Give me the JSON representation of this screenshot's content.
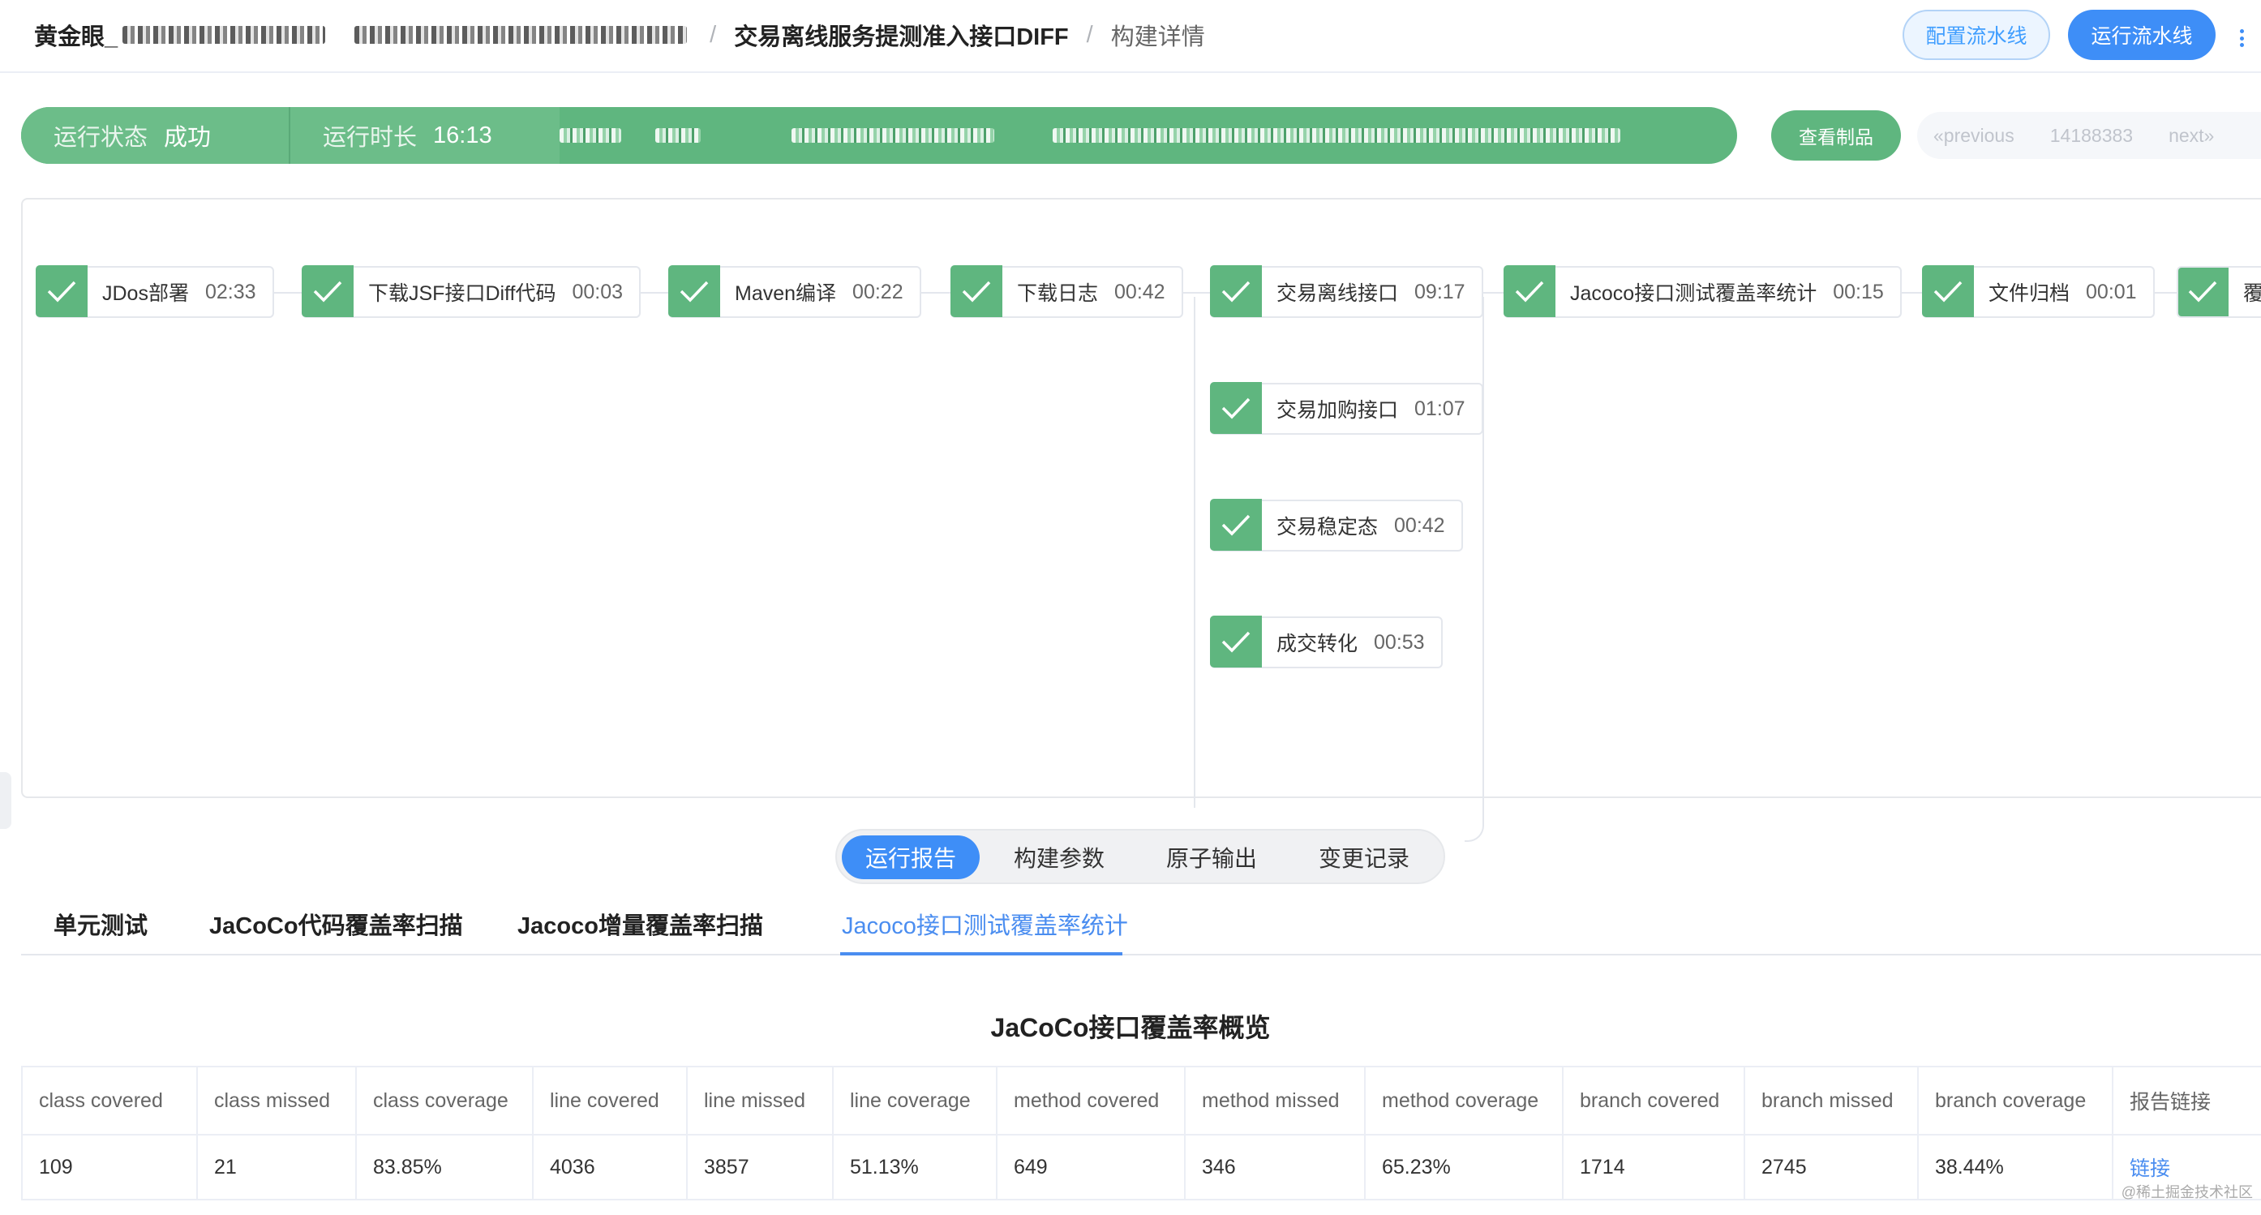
{
  "header": {
    "breadcrumb_root": "黄金眼_",
    "breadcrumb_sep": "/",
    "breadcrumb_pipeline": "交易离线服务提测准入接口DIFF",
    "breadcrumb_current": "构建详情",
    "config_button": "配置流水线",
    "run_button": "运行流水线"
  },
  "status": {
    "state_label": "运行状态",
    "state_value": "成功",
    "duration_label": "运行时长",
    "duration_value": "16:13",
    "artifact_button": "查看制品",
    "pager_prev": "«previous",
    "pager_build": "14188383",
    "pager_next": "next»"
  },
  "pipeline": {
    "stages": [
      {
        "name": "JDos部署",
        "duration": "02:33"
      },
      {
        "name": "下载JSF接口Diff代码",
        "duration": "00:03"
      },
      {
        "name": "Maven编译",
        "duration": "00:22"
      },
      {
        "name": "下载日志",
        "duration": "00:42"
      },
      {
        "name": "交易离线接口",
        "duration": "09:17"
      },
      {
        "name": "交易加购接口",
        "duration": "01:07"
      },
      {
        "name": "交易稳定态",
        "duration": "00:42"
      },
      {
        "name": "成交转化",
        "duration": "00:53"
      },
      {
        "name": "Jacoco接口测试覆盖率统计",
        "duration": "00:15"
      },
      {
        "name": "文件归档",
        "duration": "00:01"
      },
      {
        "name": "覆",
        "duration": ""
      }
    ],
    "status_color": "#5fb67f"
  },
  "tabs": {
    "primary": [
      "运行报告",
      "构建参数",
      "原子输出",
      "变更记录"
    ],
    "primary_active": "运行报告",
    "secondary": [
      "单元测试",
      "JaCoCo代码覆盖率扫描",
      "Jacoco增量覆盖率扫描",
      "Jacoco接口测试覆盖率统计"
    ],
    "secondary_active": "Jacoco接口测试覆盖率统计"
  },
  "report": {
    "title": "JaCoCo接口覆盖率概览",
    "columns": [
      "class covered",
      "class missed",
      "class coverage",
      "line covered",
      "line missed",
      "line coverage",
      "method covered",
      "method missed",
      "method coverage",
      "branch covered",
      "branch missed",
      "branch coverage",
      "报告链接"
    ],
    "row": [
      "109",
      "21",
      "83.85%",
      "4036",
      "3857",
      "51.13%",
      "649",
      "346",
      "65.23%",
      "1714",
      "2745",
      "38.44%",
      "链接"
    ]
  },
  "footer": {
    "credit": "@稀土掘金技术社区"
  },
  "colors": {
    "accent": "#3e8ef7",
    "success": "#5fb67f",
    "link": "#4a8df0"
  }
}
